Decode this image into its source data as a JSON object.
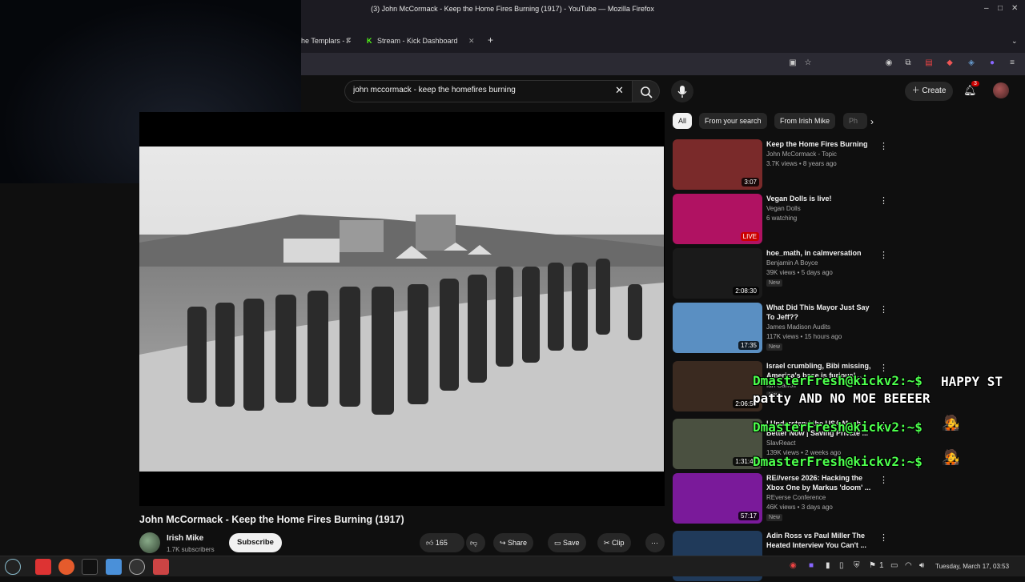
{
  "window": {
    "title": "(3) John McCormack - Keep the Home Fires Burning (1917) - YouTube — Mozilla Firefox"
  },
  "tabs": [
    {
      "label": "he Templars - F"
    },
    {
      "label": "Stream - Kick Dashboard"
    }
  ],
  "search": {
    "value": "john mccormack - keep the homefires burning"
  },
  "header": {
    "create_label": "Create",
    "notification_count": "3"
  },
  "chips": [
    "All",
    "From your search",
    "From Irish Mike",
    "Ph"
  ],
  "video": {
    "title": "John McCormack - Keep the Home Fires Burning (1917)",
    "channel": "Irish Mike",
    "subscribers": "1.7K subscribers",
    "subscribe_label": "Subscribe",
    "likes": "165",
    "share_label": "Share",
    "save_label": "Save",
    "clip_label": "Clip"
  },
  "recommendations": [
    {
      "title": "Keep the Home Fires Burning",
      "channel": "John McCormack - Topic",
      "meta": "3.7K views • 8 years ago",
      "duration": "3:07",
      "new": "",
      "thumb_color": "#7a2a2a"
    },
    {
      "title": "Vegan Dolls  is live!",
      "channel": "Vegan Dolls",
      "meta": "6 watching",
      "duration": "LIVE",
      "new": "",
      "thumb_color": "#b01262"
    },
    {
      "title": "hoe_math, in calmversation",
      "channel": "Benjamin A Boyce",
      "meta": "39K views • 5 days ago",
      "duration": "2:08:30",
      "new": "New",
      "thumb_color": "#1a1a1a"
    },
    {
      "title": "What Did This Mayor Just Say To Jeff??",
      "channel": "James Madison Audits",
      "meta": "117K views • 15 hours ago",
      "duration": "17:35",
      "new": "New",
      "thumb_color": "#5a8fc2"
    },
    {
      "title": "Israel crumbling, Bibi missing, America's base is furious!...",
      "channel": "Ian Carroll",
      "meta": "",
      "duration": "2:06:50",
      "new": "New",
      "thumb_color": "#3a2a20"
    },
    {
      "title": "I Understand the USA Much Better Now | Saving Private ...",
      "channel": "SlavReact",
      "meta": "139K views • 2 weeks ago",
      "duration": "1:31:40",
      "new": "",
      "thumb_color": "#4a5040"
    },
    {
      "title": "RE//verse 2026: Hacking the Xbox One by Markus 'doom' ...",
      "channel": "REverse Conference",
      "meta": "46K views • 3 days ago",
      "duration": "57:17",
      "new": "New",
      "thumb_color": "#7a1a9a"
    },
    {
      "title": "Adin Ross vs Paul Miller The Heated Interview You Can't ...",
      "channel": "",
      "meta": "",
      "duration": "",
      "new": "",
      "thumb_color": "#203a5a"
    }
  ],
  "chat_overlay": [
    {
      "user": "DmasterFresh@kickv2:~$",
      "message": "HAPPY ST patty AND NO MOE BEEEER"
    },
    {
      "user": "DmasterFresh@kickv2:~$",
      "message": ""
    },
    {
      "user": "DmasterFresh@kickv2:~$",
      "message": ""
    }
  ],
  "taskbar": {
    "workspace": "1",
    "clock": "Tuesday, March 17, 03:53"
  },
  "colors": {
    "overlay_user": "#4cff4c",
    "overlay_msg": "#ffffff",
    "live_badge": "#cc0000"
  }
}
